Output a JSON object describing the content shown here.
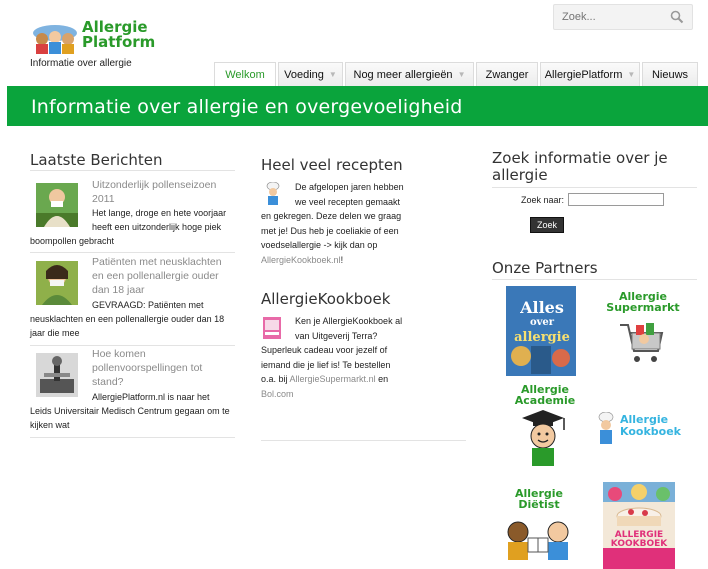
{
  "header": {
    "logo_line1": "Allergie",
    "logo_line2": "Platform",
    "tagline": "Informatie over allergie",
    "search_placeholder": "Zoek..."
  },
  "nav": {
    "tabs": [
      {
        "label": "Welkom",
        "active": true,
        "dropdown": false
      },
      {
        "label": "Voeding",
        "active": false,
        "dropdown": true
      },
      {
        "label": "Nog meer allergieën",
        "active": false,
        "dropdown": true
      },
      {
        "label": "Zwanger",
        "active": false,
        "dropdown": false
      },
      {
        "label": "AllergiePlatform",
        "active": false,
        "dropdown": true
      },
      {
        "label": "Nieuws",
        "active": false,
        "dropdown": false
      }
    ]
  },
  "banner": {
    "title": "Informatie over allergie en overgevoeligheid"
  },
  "latest": {
    "title": "Laatste Berichten",
    "posts": [
      {
        "title_lines": [
          "Uitzonderlijk pollenseizoen",
          "2011"
        ],
        "body_lines": [
          "Het lange, droge en hete voorjaar",
          "heeft een uitzonderlijk hoge piek",
          "boompollen gebracht"
        ]
      },
      {
        "title_lines": [
          "Patiënten met neusklachten",
          "en een pollenallergie ouder",
          "dan 18 jaar"
        ],
        "body_lines": [
          "GEVRAAGD: Patiënten met",
          "neusklachten en een pollenallergie ouder dan 18",
          "jaar die mee"
        ]
      },
      {
        "title_lines": [
          "Hoe komen",
          "pollenvoorspellingen tot",
          "stand?"
        ],
        "body_lines": [
          "AllergiePlatform.nl is naar het",
          "Leids Universitair Medisch Centrum gegaan om te",
          "kijken wat"
        ]
      }
    ]
  },
  "recipes": {
    "title": "Heel veel recepten",
    "lines": [
      "De afgelopen jaren hebben",
      "we veel recepten gemaakt",
      "en gekregen. Deze delen we graag",
      "met je! Dus heb je coeliakie of een",
      "voedselallergie -> kijk dan op"
    ],
    "link": "AllergieKookboek.nl",
    "link_suffix": "!"
  },
  "cookbook": {
    "title": "AllergieKookboek",
    "lines": [
      "Ken je AllergieKookboek al",
      "van Uitgeverij Terra?",
      "Superleuk cadeau voor jezelf of",
      "iemand die je lief is! Te bestellen"
    ],
    "line5_prefix": "o.a. bij ",
    "link1": "AllergieSupermarkt.nl",
    "line5_suffix": " en",
    "link2": "Bol.com"
  },
  "search_panel": {
    "title_line1": "Zoek informatie over je",
    "title_line2": "allergie",
    "label": "Zoek naar:",
    "button": "Zoek"
  },
  "partners": {
    "title": "Onze Partners",
    "book_cover_lines": [
      "Alles",
      "over",
      "allergie"
    ],
    "supermarkt": [
      "Allergie",
      "Supermarkt"
    ],
    "academie": [
      "Allergie",
      "Academie"
    ],
    "kookboek": [
      "Allergie",
      "Kookboek"
    ],
    "dietist": [
      "Allergie",
      "Diëtist"
    ],
    "kookboek_cover": [
      "ALLERGIE",
      "KOOKBOEK"
    ]
  },
  "colors": {
    "green": "#0aa43c",
    "logo_green": "#2a9a2a",
    "link_gray": "#8a8a8a"
  },
  "icons": [
    "search-icon",
    "chef-icon",
    "book-icon",
    "caret-down-icon"
  ]
}
